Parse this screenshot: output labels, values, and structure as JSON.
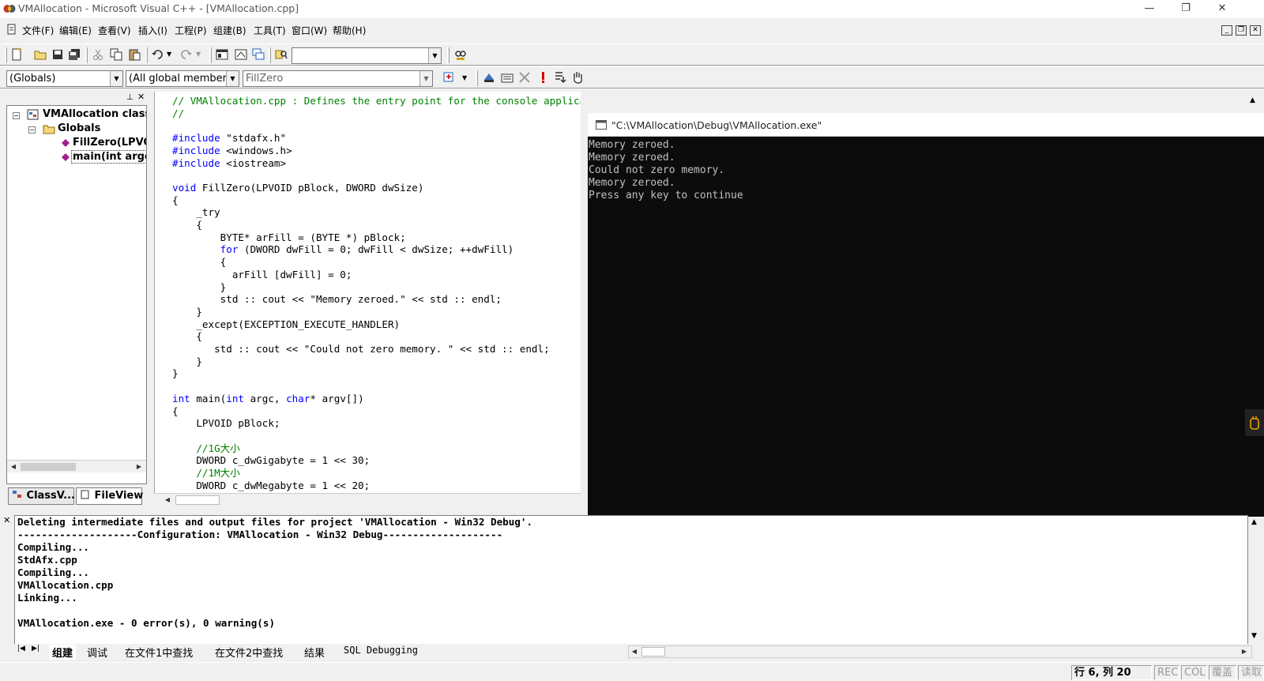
{
  "window": {
    "title": "VMAllocation - Microsoft Visual C++ - [VMAllocation.cpp]",
    "minimize": "—",
    "restore": "❐",
    "close": "✕"
  },
  "menu": [
    "文件(F)",
    "编辑(E)",
    "查看(V)",
    "插入(I)",
    "工程(P)",
    "组建(B)",
    "工具(T)",
    "窗口(W)",
    "帮助(H)"
  ],
  "mdi": {
    "min": "_",
    "restore": "❐",
    "close": "✕"
  },
  "wizard": {
    "scope": "(Globals)",
    "filter": "(All global members",
    "function": "FillZero"
  },
  "workspace": {
    "tree": [
      {
        "label": "VMAllocation classe",
        "level": 0
      },
      {
        "label": "Globals",
        "level": 1
      },
      {
        "label": "FillZero(LPVO",
        "level": 2
      },
      {
        "label": "main(int argc,",
        "level": 2
      }
    ],
    "tabs": [
      "ClassV...",
      "FileView"
    ]
  },
  "editor": {
    "lines": [
      "// VMAllocation.cpp : Defines the entry point for the console application.",
      "//",
      "",
      "#include \"stdafx.h\"",
      "#include <windows.h>",
      "#include <iostream>",
      "",
      "void FillZero(LPVOID pBlock, DWORD dwSize)",
      "{",
      "    _try",
      "    {",
      "        BYTE* arFill = (BYTE *) pBlock;",
      "        for (DWORD dwFill = 0; dwFill < dwSize; ++dwFill)",
      "        {",
      "          arFill [dwFill] = 0;",
      "        }",
      "        std :: cout << \"Memory zeroed.\" << std :: endl;",
      "    }",
      "    _except(EXCEPTION_EXECUTE_HANDLER)",
      "    {",
      "       std :: cout << \"Could not zero memory. \" << std :: endl;",
      "    }",
      "}",
      "",
      "int main(int argc, char* argv[])",
      "{",
      "    LPVOID pBlock;",
      "",
      "    //1G大小",
      "    DWORD c_dwGigabyte = 1 << 30;",
      "    //1M大小",
      "    DWORD c_dwMegabyte = 1 << 20;"
    ]
  },
  "console": {
    "title": "\"C:\\VMAllocation\\Debug\\VMAllocation.exe\"",
    "lines": [
      "Memory zeroed.",
      "Memory zeroed.",
      "Could not zero memory.",
      "Memory zeroed.",
      "Press any key to continue"
    ]
  },
  "output": {
    "lines": [
      "Deleting intermediate files and output files for project 'VMAllocation - Win32 Debug'.",
      "--------------------Configuration: VMAllocation - Win32 Debug--------------------",
      "Compiling...",
      "StdAfx.cpp",
      "Compiling...",
      "VMAllocation.cpp",
      "Linking...",
      "",
      "VMAllocation.exe - 0 error(s), 0 warning(s)"
    ],
    "tabs": [
      "组建",
      "调试",
      "在文件1中查找",
      "在文件2中查找",
      "结果",
      "SQL Debugging"
    ]
  },
  "status": {
    "position": "行 6, 列 20",
    "rec": "REC",
    "col": "COL",
    "ovr": "覆盖",
    "read": "读取"
  },
  "colors": {
    "keyword": "#0000ff",
    "comment": "#008000",
    "console_bg": "#0c0c0c",
    "console_text": "#c0c0c0"
  }
}
